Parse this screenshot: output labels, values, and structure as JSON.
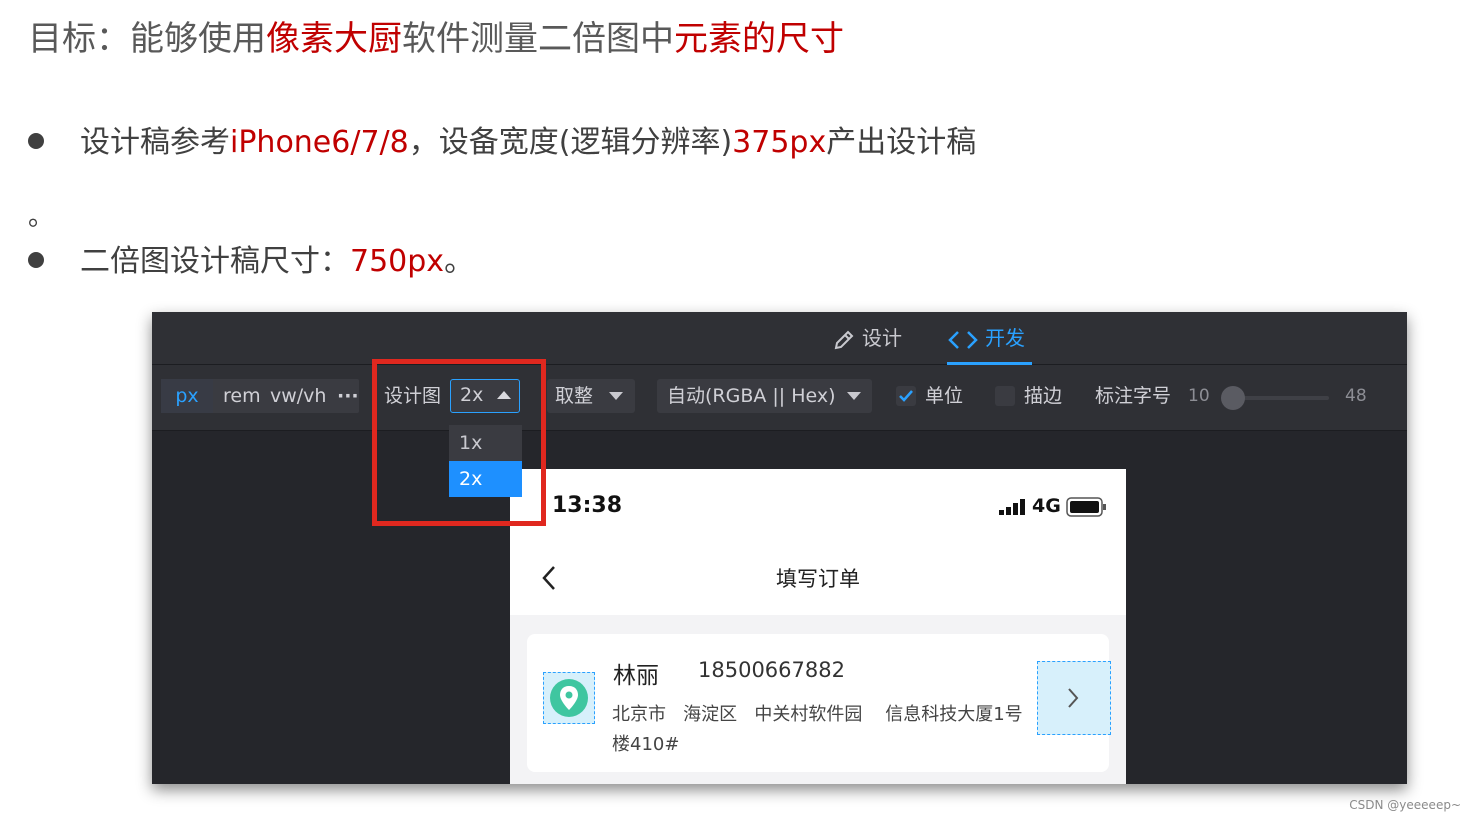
{
  "heading": {
    "part1": "目标：能够使用",
    "part2": "像素大厨",
    "part3": "软件测量二倍图中",
    "part4": "元素的尺寸"
  },
  "bullets": [
    {
      "a": "设计稿参考",
      "b": "iPhone6/7/8",
      "c": "，设备宽度(逻辑分辨率)",
      "d": "375px",
      "e": "产出设计稿"
    },
    {
      "a": "二倍图设计稿尺寸：",
      "b": "750px",
      "c": "。"
    }
  ],
  "period": "。",
  "app": {
    "tabs": [
      {
        "label": "设计",
        "icon": "pencil-icon"
      },
      {
        "label": "开发",
        "icon": "code-icon",
        "active": true
      }
    ],
    "units": {
      "px": "px",
      "rem": "rem",
      "vw": "vw/vh",
      "more": "···"
    },
    "design_scale": {
      "label": "设计图",
      "value": "2x",
      "options": [
        "1x",
        "2x"
      ],
      "selected": "2x"
    },
    "rounding": {
      "label": "取整"
    },
    "color_format": {
      "label": "自动(RGBA || Hex)"
    },
    "unit_checkbox": {
      "label": "单位",
      "checked": true
    },
    "border_checkbox": {
      "label": "描边",
      "checked": false
    },
    "font_size": {
      "label": "标注字号",
      "min": "10",
      "max": "48",
      "value": 10
    },
    "colors": {
      "accent": "#2aa1ff",
      "highlight": "#e0281f"
    }
  },
  "phone": {
    "time": "13:38",
    "network": "4G",
    "title": "填写订单",
    "contact": {
      "name": "林丽",
      "phone": "18500667882"
    },
    "address_line1": "北京市   海淀区   中关村软件园    信息科技大厦1号",
    "address_line2": "楼410#"
  },
  "watermark": "CSDN @yeeeeep~"
}
